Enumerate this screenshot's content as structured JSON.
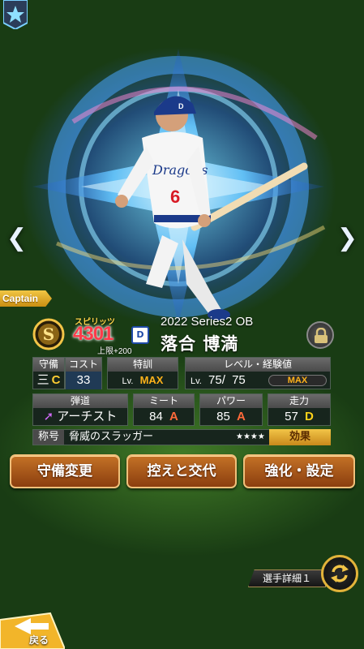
{
  "nav": {
    "prev_icon": "chevron-left-icon",
    "next_icon": "chevron-right-icon",
    "prev_glyph": "❮",
    "next_glyph": "❯"
  },
  "captain_label": "Captain",
  "card": {
    "rank_letter": "S",
    "spirits_label": "スピリッツ",
    "spirits_value": "4301",
    "spirits_bonus": "上限+200",
    "team_logo_text": "D",
    "series": "2022 Series2 OB",
    "name": "落合 博満"
  },
  "stats": {
    "position": {
      "label": "守備",
      "value": "三",
      "grade": "C"
    },
    "cost": {
      "label": "コスト",
      "value": "33"
    },
    "training": {
      "label": "特訓",
      "lv_prefix": "Lv.",
      "value": "MAX"
    },
    "level": {
      "label": "レベル・経験値",
      "lv_prefix": "Lv.",
      "current": "75",
      "separator": "/",
      "max": "75",
      "exp_label": "MAX"
    },
    "trajectory": {
      "label": "弾道",
      "value": "アーチスト"
    },
    "meet": {
      "label": "ミート",
      "value": "84",
      "grade": "A"
    },
    "power": {
      "label": "パワー",
      "value": "85",
      "grade": "A"
    },
    "speed": {
      "label": "走力",
      "value": "57",
      "grade": "D"
    }
  },
  "title_row": {
    "label": "称号",
    "value": "脅威のスラッガー",
    "stars": "★★★★",
    "effect_button": "効果"
  },
  "buttons": {
    "change_position": "守備変更",
    "bench_swap": "控えと交代",
    "enhance": "強化・設定"
  },
  "detail_button": "選手詳細１",
  "back_label": "戻る",
  "colors": {
    "accent_gold": "#f2c447",
    "button_brown": "#c47226",
    "spirits_red": "#ff3b4a"
  }
}
